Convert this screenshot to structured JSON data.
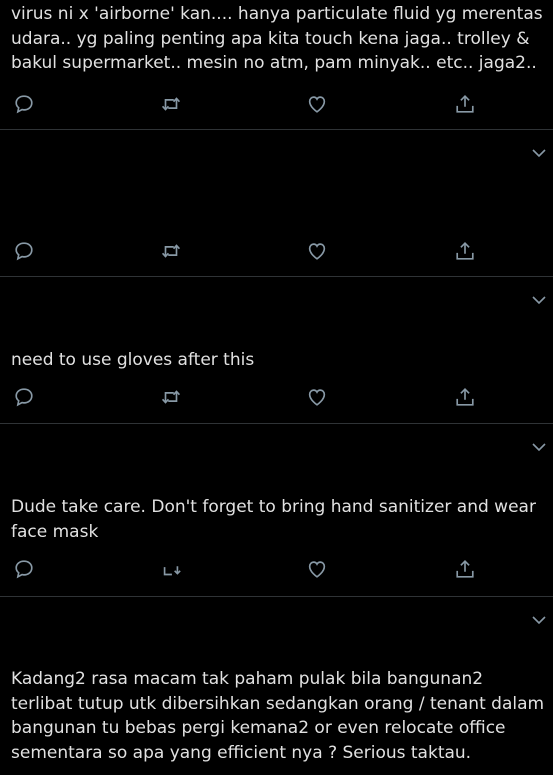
{
  "tweets": [
    {
      "text": "virus ni x 'airborne' kan.... hanya particulate fluid yg merentas udara.. yg paling penting apa kita touch kena jaga.. trolley & bakul supermarket.. mesin no atm, pam minyak.. etc.. jaga2..",
      "retweet_icon": "retweet-icon"
    },
    {
      "text": "",
      "retweet_icon": "retweet-icon"
    },
    {
      "text": "need to use gloves after this",
      "retweet_icon": "retweet-icon"
    },
    {
      "text": "Dude take care. Don't forget to bring hand sanitizer and wear face mask",
      "retweet_icon": "retweet-disabled-icon"
    },
    {
      "text": "Kadang2 rasa macam tak paham pulak bila bangunan2 terlibat tutup utk dibersihkan sedangkan orang / tenant dalam bangunan tu bebas pergi kemana2 or even relocate office sementara so apa yang efficient nya ? Serious taktau."
    }
  ],
  "icons": {
    "reply": "reply-icon",
    "like": "heart-icon",
    "share": "share-icon",
    "menu": "chevron-down-icon"
  },
  "colors": {
    "background": "#000000",
    "text": "#e1e1e1",
    "icon": "#8899a6",
    "separator": "#2f3336"
  }
}
